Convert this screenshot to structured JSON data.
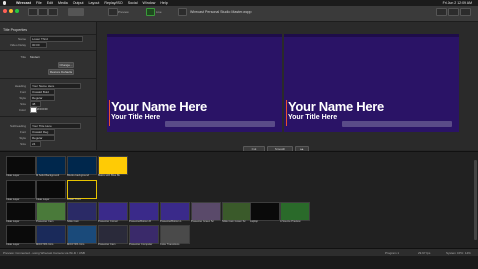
{
  "menubar": {
    "app": "Wirecast",
    "items": [
      "File",
      "Edit",
      "Media",
      "Output",
      "Layout",
      "Replay/ISO",
      "Social",
      "Window",
      "Help"
    ],
    "clock": "Fri Jun 2  12:09 AM"
  },
  "window": {
    "title": "Wirecast Personal Studio Master.wcpp",
    "preview_label": "Preview",
    "live_label": "Live"
  },
  "properties": {
    "header": "Title Properties",
    "name_label": "Name",
    "name_value": "Lower Third",
    "video_delay_label": "Video Delay",
    "video_delay_value": "00:00",
    "title_label": "Title",
    "title_value": "Modern",
    "change_button": "Change...",
    "restore_button": "Restore Defaults",
    "heading_section": {
      "label": "Heading",
      "value": "Your Name Here",
      "font_label": "Font",
      "font_value": "Oswald Bold",
      "style_label": "Style",
      "style_value": "Regular",
      "size_label": "Size",
      "size_value": "48",
      "color_label": "Color",
      "color_value": "#FFFFFF"
    },
    "subheading_section": {
      "label": "Subheading",
      "value": "Your Title Here",
      "font_label": "Font",
      "font_value": "Oswald Reg",
      "style_label": "Style",
      "style_value": "Regular",
      "size_label": "Size",
      "size_value": "24"
    }
  },
  "preview": {
    "heading_text": "Your Name Here",
    "sub_text": "Your Title Here"
  },
  "live": {
    "heading_text": "Your Name Here",
    "sub_text": "Your Title Here"
  },
  "controls": {
    "cut": "Cut",
    "smooth": "Smooth",
    "go": "▸▸"
  },
  "shots": [
    {
      "label": "Clear Layer",
      "bg": "#0a0a0a",
      "selected": false
    },
    {
      "label": "M Solid Background",
      "bg": "#00274c",
      "selected": false
    },
    {
      "label": "Blocks background",
      "bg": "#00274c",
      "selected": false
    },
    {
      "label": "Maize with Blue Bk",
      "bg": "#ffcb05",
      "selected": false
    },
    {
      "label": "Clear Layer",
      "bg": "#0a0a0a",
      "selected": false
    },
    {
      "label": "Clear Layer",
      "bg": "#0a0a0a",
      "selected": false
    },
    {
      "label": "Lower Third",
      "bg": "#1a1a1a",
      "selected": true
    },
    {
      "label": "Clear Layer",
      "bg": "#0a0a0a",
      "selected": false
    },
    {
      "label": "Presenter Cam",
      "bg": "#4a7a3a",
      "selected": false
    },
    {
      "label": "Slide Cam",
      "bg": "#2a2a66",
      "selected": false
    },
    {
      "label": "Presenter Corner",
      "bg": "#3a2a8a",
      "selected": false
    },
    {
      "label": "PresenterBottom R",
      "bg": "#3a2a8a",
      "selected": false
    },
    {
      "label": "PresenterBottom L",
      "bg": "#3a2a8a",
      "selected": false
    },
    {
      "label": "Presenter Green Sc",
      "bg": "#5a4a6a",
      "selected": false
    },
    {
      "label": "Slide Cam Green Sc",
      "bg": "#3a5a2a",
      "selected": false
    },
    {
      "label": "Laptop",
      "bg": "#0a0a0a",
      "selected": false
    },
    {
      "label": "A Source Preview",
      "bg": "#2a6a2a",
      "selected": false
    },
    {
      "label": "Clear Layer",
      "bg": "#0a0a0a",
      "selected": false
    },
    {
      "label": "MOOTRS Intro",
      "bg": "#1a2a5a",
      "selected": false
    },
    {
      "label": "MOOTRS Intro",
      "bg": "#1a4a7a",
      "selected": false
    },
    {
      "label": "Presenter Cam",
      "bg": "#2a2a3a",
      "selected": false
    },
    {
      "label": "Presenter Computer",
      "bg": "#3a2a6a",
      "selected": false
    },
    {
      "label": "Color Transitions",
      "bg": "#4a4a4a",
      "selected": false
    }
  ],
  "status": {
    "left": "Preview: Connected - using Wirecast Camera via Wi-Fi / USB",
    "mid": "Program 1",
    "fps": "29.97 fps",
    "right": "System CPU: 14%"
  }
}
